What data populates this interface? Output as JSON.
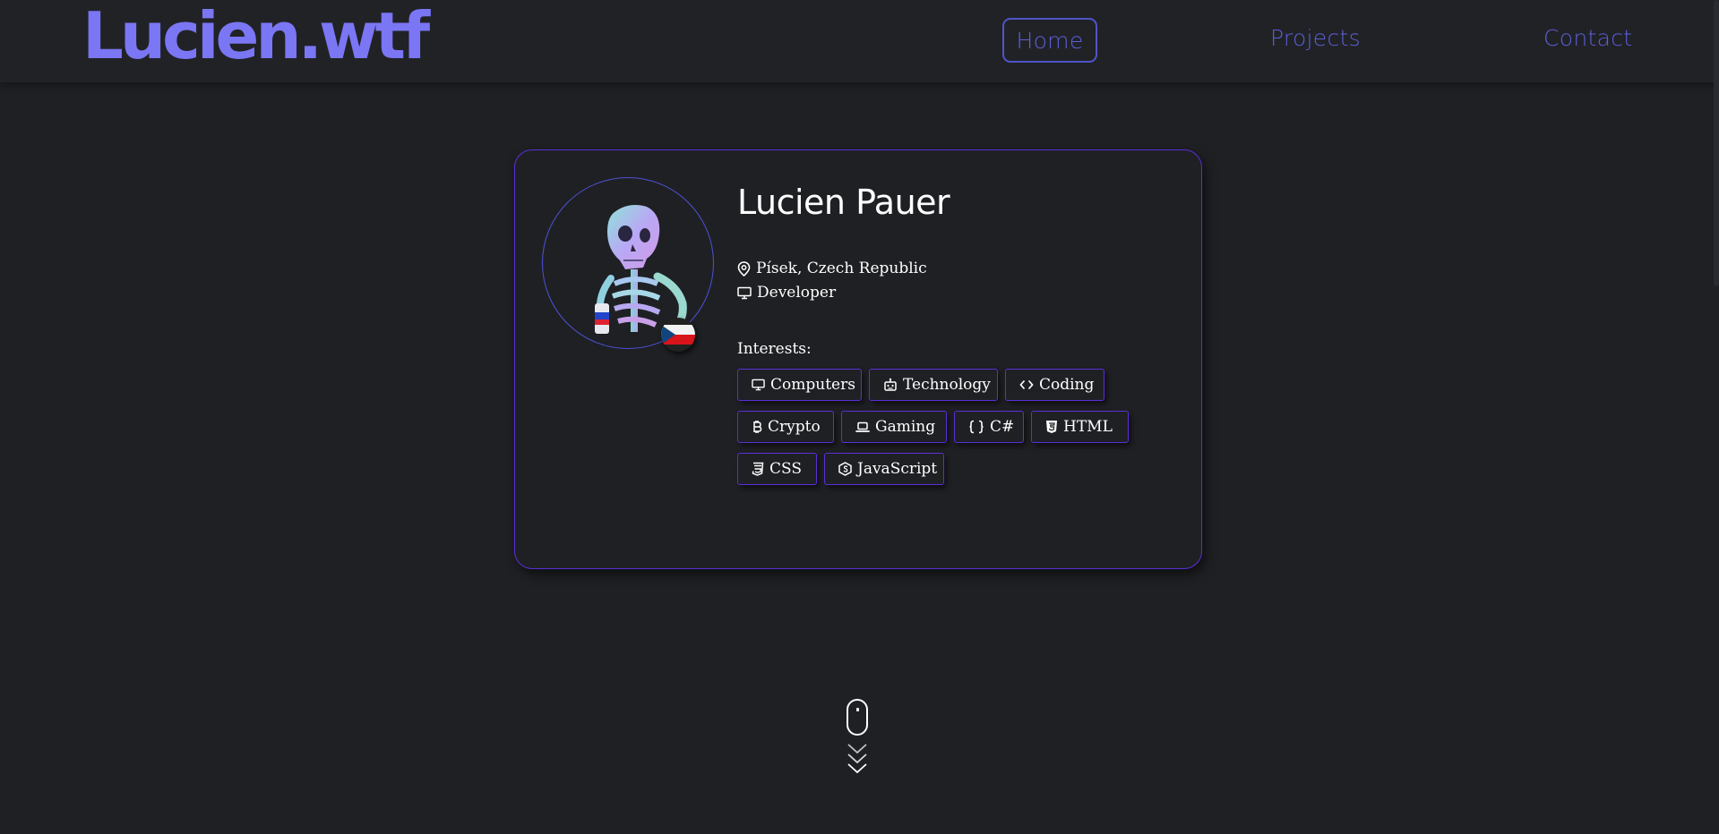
{
  "site": {
    "logo": "Lucien.wtf"
  },
  "nav": {
    "home": "Home",
    "projects": "Projects",
    "contact": "Contact"
  },
  "profile": {
    "name": "Lucien Pauer",
    "location": "Písek, Czech Republic",
    "role": "Developer",
    "interests_label": "Interests:",
    "interests": [
      {
        "label": "Computers",
        "icon": "monitor-icon"
      },
      {
        "label": "Technology",
        "icon": "robot-icon"
      },
      {
        "label": "Coding",
        "icon": "code-icon"
      },
      {
        "label": "Crypto",
        "icon": "bitcoin-icon"
      },
      {
        "label": "Gaming",
        "icon": "laptop-icon"
      },
      {
        "label": "C#",
        "icon": "braces-icon"
      },
      {
        "label": "HTML",
        "icon": "html5-icon"
      },
      {
        "label": "CSS",
        "icon": "css3-icon"
      },
      {
        "label": "JavaScript",
        "icon": "nodejs-icon"
      }
    ]
  },
  "colors": {
    "accent": "#7a76f4",
    "nav": "#5b5fd6",
    "border": "#5b2fd8",
    "background": "#1f2024"
  }
}
